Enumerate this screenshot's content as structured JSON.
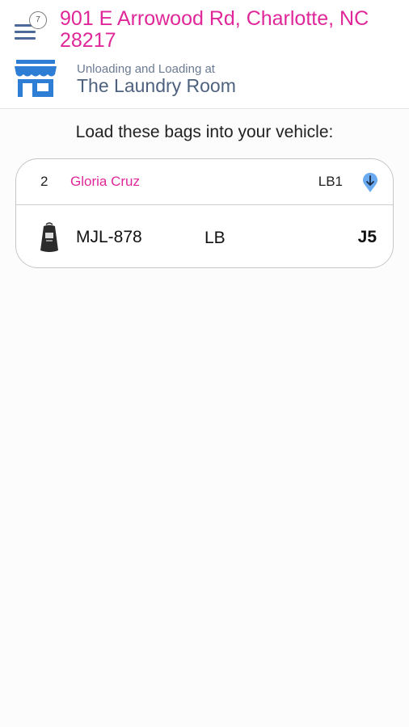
{
  "header": {
    "notification_count": "7",
    "address": "901 E Arrowood Rd, Charlotte, NC 28217",
    "status_label": "Unloading and Loading at",
    "location_name": "The Laundry Room"
  },
  "main": {
    "instruction": "Load these bags into your vehicle:",
    "order": {
      "number": "2",
      "customer": "Gloria Cruz",
      "bag_code": "LB1",
      "bags": [
        {
          "id": "MJL-878",
          "type": "LB",
          "slot": "J5"
        }
      ]
    }
  },
  "colors": {
    "accent": "#e0279a",
    "primary_blue": "#2f7ed6",
    "nav_blue": "#4c6a99",
    "arrow_blue": "#6aaaf0"
  },
  "icons": [
    "menu-icon",
    "store-icon",
    "arrow-down-icon",
    "laundry-bag-icon"
  ]
}
